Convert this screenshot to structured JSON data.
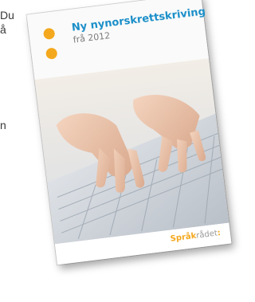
{
  "background_text": [
    "Du",
    "å",
    "n"
  ],
  "booklet": {
    "title": "Ny nynorskrettskriving",
    "subtitle": "frå 2012",
    "logo": {
      "part1": "Språk",
      "part2": "rådet",
      "mark": ":"
    }
  },
  "colors": {
    "accent_orange": "#f4a81d",
    "title_blue": "#1b8fc9",
    "subtitle_grey": "#7a7a7a"
  }
}
